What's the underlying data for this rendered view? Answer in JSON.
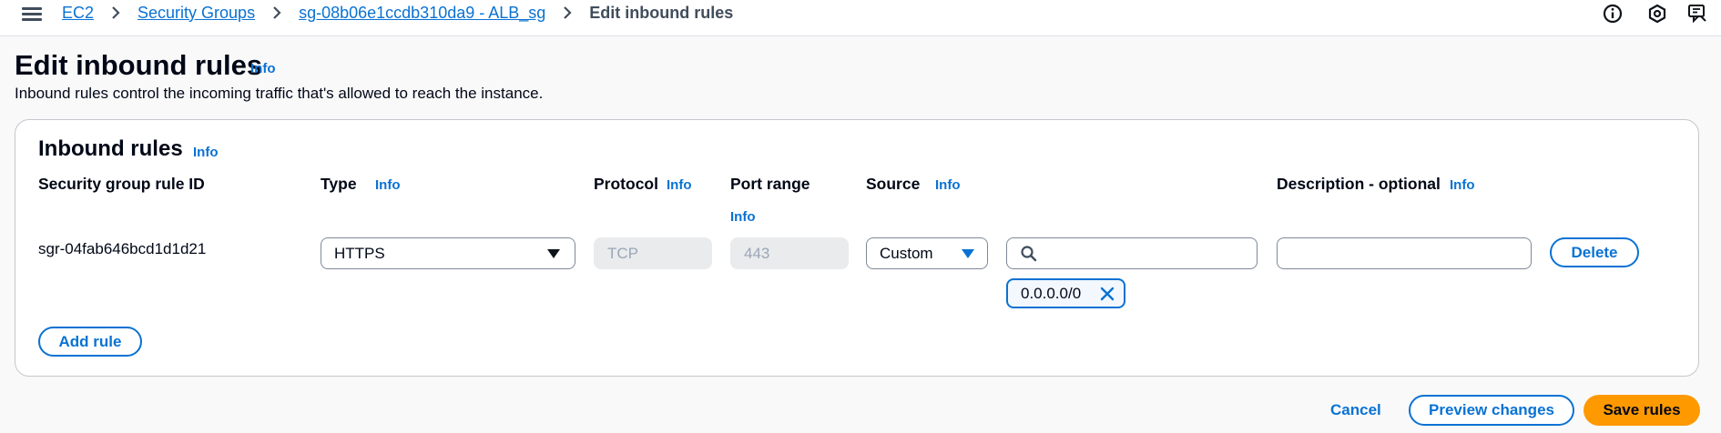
{
  "breadcrumb": {
    "items": [
      {
        "label": "EC2"
      },
      {
        "label": "Security Groups"
      },
      {
        "label": "sg-08b06e1ccdb310da9 - ALB_sg"
      }
    ],
    "current": "Edit inbound rules"
  },
  "header": {
    "title": "Edit inbound rules",
    "info": "Info",
    "description": "Inbound rules control the incoming traffic that's allowed to reach the instance."
  },
  "top_icons": [
    "info-circle-icon",
    "settings-hex-icon",
    "feedback-icon"
  ],
  "panel": {
    "title": "Inbound rules",
    "info": "Info",
    "columns": {
      "rule_id": "Security group rule ID",
      "type": "Type",
      "protocol": "Protocol",
      "port_range": "Port range",
      "source": "Source",
      "description": "Description - optional"
    },
    "info_label": "Info",
    "rule": {
      "id": "sgr-04fab646bcd1d1d21",
      "type": "HTTPS",
      "protocol": "TCP",
      "port": "443",
      "source_type": "Custom",
      "source_search": "",
      "source_token": "0.0.0.0/0",
      "description": "",
      "delete_label": "Delete"
    },
    "add_rule_label": "Add rule"
  },
  "footer": {
    "cancel": "Cancel",
    "preview": "Preview changes",
    "save": "Save rules"
  },
  "colors": {
    "link": "#0972d3",
    "primary_button": "#ff9900",
    "text": "#000716",
    "disabled_bg": "#e9ebed"
  }
}
